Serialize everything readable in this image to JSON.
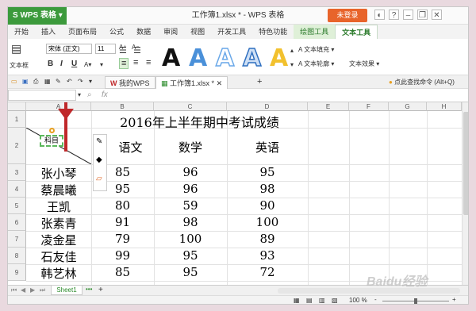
{
  "app": {
    "name": "WPS 表格",
    "window_title": "工作簿1.xlsx * - WPS 表格",
    "login": "未登录"
  },
  "ribbon_tabs": [
    "开始",
    "插入",
    "页面布局",
    "公式",
    "数据",
    "审阅",
    "视图",
    "开发工具",
    "特色功能",
    "绘图工具",
    "文本工具"
  ],
  "ribbon": {
    "textbox_label": "文本框",
    "font_name": "宋体 (正文)",
    "font_size": "11",
    "bold": "B",
    "italic": "I",
    "underline": "U",
    "text_fill": "文本填充",
    "text_outline": "文本轮廓",
    "text_effect": "文本效果",
    "style_glyph": "A",
    "colors": {
      "style1": "#111111",
      "style2": "#4a90d9",
      "style3": "#6aa8e8",
      "style4": "#2f6fc0",
      "style5": "#f2c12e"
    }
  },
  "doc_tabs": {
    "home": "我的WPS",
    "active": "工作簿1.xlsx *",
    "add": "+"
  },
  "find_cmd": "点此查找命令 (Alt+Q)",
  "formula_bar": {
    "fx": "fx"
  },
  "columns": [
    "A",
    "B",
    "C",
    "D",
    "E",
    "F",
    "G",
    "H"
  ],
  "rows": [
    "1",
    "2",
    "3",
    "4",
    "5",
    "6",
    "7",
    "8",
    "9"
  ],
  "sheet": {
    "title": "2016年上半年期中考试成绩",
    "diag_label": "科目",
    "headers": [
      "语文",
      "数学",
      "英语"
    ],
    "data": [
      [
        "张小琴",
        "85",
        "96",
        "95"
      ],
      [
        "蔡晨曦",
        "95",
        "96",
        "98"
      ],
      [
        "王凯",
        "80",
        "59",
        "90"
      ],
      [
        "张素青",
        "91",
        "98",
        "100"
      ],
      [
        "凌金星",
        "79",
        "100",
        "89"
      ],
      [
        "石友佳",
        "99",
        "95",
        "93"
      ],
      [
        "韩艺林",
        "85",
        "95",
        "72"
      ]
    ]
  },
  "sheetbar": {
    "sheet_name": "Sheet1",
    "add": "+"
  },
  "status": {
    "zoom": "100 %",
    "minus": "-",
    "plus": "+"
  },
  "watermark": "Baidu经验"
}
